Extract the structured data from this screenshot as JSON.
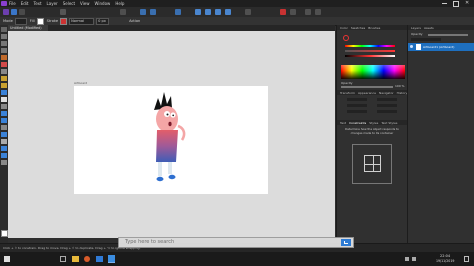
{
  "menu": [
    "File",
    "Edit",
    "Text",
    "Layer",
    "Select",
    "View",
    "Window",
    "Help"
  ],
  "context": {
    "mode_label": "Mode",
    "fill_label": "Fill",
    "stroke_label": "Stroke",
    "dropdown_value": "Normal",
    "size_value": "0 px",
    "action_label": "Action"
  },
  "document_tab": "Untitled (Modified) 100.0%",
  "canvas_label": "Artboard",
  "right_panel": {
    "tabs1": [
      "Color",
      "Swatches",
      "Brushes"
    ],
    "opacity_label": "Opacity",
    "opacity_value": "100 %",
    "tabs2": [
      "Transform",
      "Appearance",
      "Navigator",
      "History"
    ],
    "tabs3": [
      "Text",
      "Constraints",
      "Styles",
      "Text Styles"
    ],
    "constraints_text": "Determine how the object responds to changes made to its container"
  },
  "layers": {
    "tabs": [
      "Layers",
      "Assets"
    ],
    "opacity_label": "Opacity",
    "layer_name": "Artboard1 (Artboard)"
  },
  "status_text": "Click + ⇧ to constrain. Drag to move. Drag + ⇧ to duplicate. Drag + ⌥ to ignore snapping.",
  "search": {
    "placeholder": "Type here to search"
  },
  "taskbar": {
    "time": "22:04",
    "date": "19/11/2019"
  },
  "colors": {
    "accent": "#1e6fbf",
    "hue_gradient": [
      "#ff0000",
      "#ffff00",
      "#00ff00",
      "#00ffff",
      "#0000ff",
      "#ff00ff",
      "#ff0000"
    ]
  }
}
